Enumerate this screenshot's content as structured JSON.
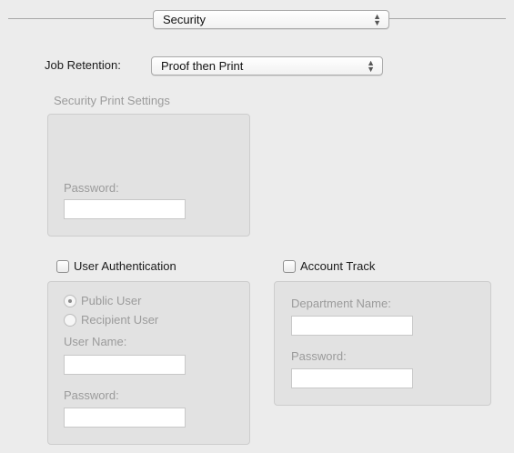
{
  "panel_selector": {
    "value": "Security"
  },
  "job_retention": {
    "label": "Job Retention:",
    "value": "Proof then Print"
  },
  "security_print": {
    "title": "Security Print Settings",
    "password_label": "Password:",
    "password_value": ""
  },
  "user_auth": {
    "checkbox_label": "User Authentication",
    "checked": false,
    "options": [
      {
        "label": "Public User",
        "selected": true
      },
      {
        "label": "Recipient User",
        "selected": false
      }
    ],
    "user_name_label": "User Name:",
    "user_name_value": "",
    "password_label": "Password:",
    "password_value": ""
  },
  "account_track": {
    "checkbox_label": "Account Track",
    "checked": false,
    "department_label": "Department Name:",
    "department_value": "",
    "password_label": "Password:",
    "password_value": ""
  },
  "icons": {
    "popup_arrows": "up-down-chevron-icon",
    "radio_dot": "radio-dot-icon"
  }
}
